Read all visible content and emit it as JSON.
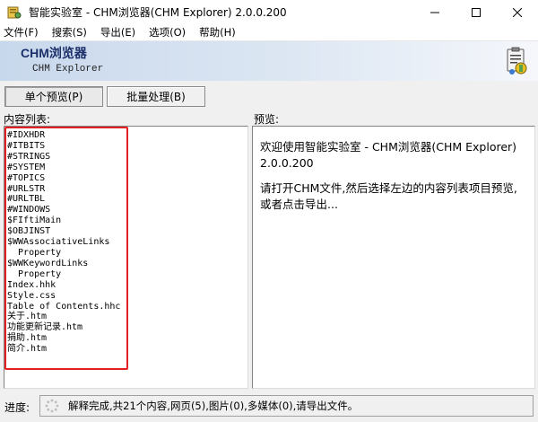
{
  "window": {
    "title": "智能实验室 - CHM浏览器(CHM Explorer) 2.0.0.200",
    "icon": "app-icon",
    "controls": [
      "minimize",
      "maximize",
      "close"
    ]
  },
  "menu": [
    {
      "label": "文件(F)"
    },
    {
      "label": "搜索(S)"
    },
    {
      "label": "导出(E)"
    },
    {
      "label": "选项(O)"
    },
    {
      "label": "帮助(H)"
    }
  ],
  "banner": {
    "title": "CHM浏览器",
    "subtitle": "CHM Explorer",
    "icon": "clipboard-wrench-icon"
  },
  "tabs": [
    {
      "label": "单个预览(P)",
      "active": true
    },
    {
      "label": "批量处理(B)",
      "active": false
    }
  ],
  "list": {
    "label": "内容列表:",
    "items": [
      "#IDXHDR",
      "#ITBITS",
      "#STRINGS",
      "#SYSTEM",
      "#TOPICS",
      "#URLSTR",
      "#URLTBL",
      "#WINDOWS",
      "$FIftiMain",
      "$OBJINST",
      "$WWAssociativeLinks",
      "  Property",
      "$WWKeywordLinks",
      "  Property",
      "Index.hhk",
      "Style.css",
      "Table of Contents.hhc",
      "关于.htm",
      "功能更新记录.htm",
      "捐助.htm",
      "简介.htm"
    ]
  },
  "preview": {
    "label": "预览:",
    "welcome": "欢迎使用智能实验室 - CHM浏览器(CHM Explorer) 2.0.0.200",
    "instruction": "请打开CHM文件,然后选择左边的内容列表项目预览,或者点击导出..."
  },
  "status": {
    "label": "进度:",
    "text": "解释完成,共21个内容,网页(5),图片(0),多媒体(0),请导出文件。"
  },
  "colors": {
    "highlight_border": "#e41f1f",
    "banner_title": "#1b2f6a",
    "banner_gradient_start": "#c8d8ec"
  }
}
